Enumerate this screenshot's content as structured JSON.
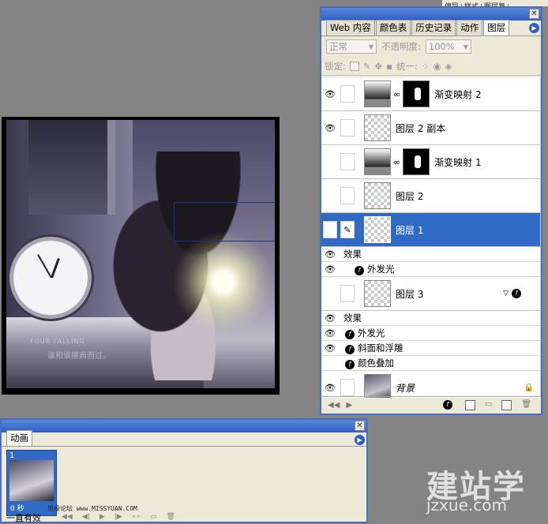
{
  "top_tabs": [
    "停导",
    "样式",
    "图层复"
  ],
  "canvas": {
    "text1": "FOUR FALLING",
    "text2": "谁和谁擦肩而过。"
  },
  "layers_panel": {
    "tabs": [
      {
        "label": "Web 内容"
      },
      {
        "label": "颜色表"
      },
      {
        "label": "历史记录"
      },
      {
        "label": "动作"
      },
      {
        "label": "图层"
      }
    ],
    "blend_mode": "正常",
    "opacity_label": "不透明度:",
    "opacity_value": "100%",
    "lock_label": "锁定:",
    "unify_label": "统一:",
    "layers": [
      {
        "name": "渐变映射 2",
        "visible": true
      },
      {
        "name": "图层 2 副本",
        "visible": true
      },
      {
        "name": "渐变映射 1",
        "visible": false
      },
      {
        "name": "图层 2",
        "visible": false
      },
      {
        "name": "图层 1",
        "visible": false,
        "selected": true
      },
      {
        "name": "图层 3",
        "visible": false
      },
      {
        "name": "背景",
        "visible": true
      }
    ],
    "effects_label": "效果",
    "layer1_effects": [
      "外发光"
    ],
    "layer3_effects": [
      "外发光",
      "斜面和浮雕",
      "颜色叠加"
    ]
  },
  "animation_panel": {
    "tab": "动画",
    "frame_number": "1",
    "frame_time": "0 秒",
    "loop": "一直有效"
  },
  "watermark": {
    "site": "思缘论坛  www.MISSYUAN.COM",
    "logo": "建站学",
    "logo_url": "jzxue.com"
  }
}
